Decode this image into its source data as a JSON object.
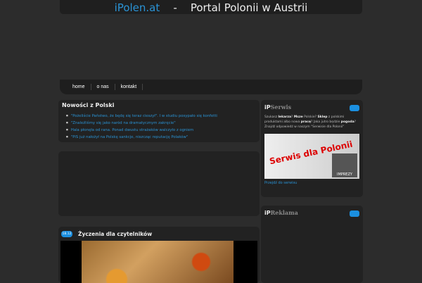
{
  "header": {
    "brand": "iPolen.at",
    "separator": "-",
    "tagline": "Portal Polonii w Austrii"
  },
  "nav": [
    {
      "label": "home"
    },
    {
      "label": "o nas"
    },
    {
      "label": "kontakt"
    }
  ],
  "news": {
    "title": "Nowości z Polski",
    "items": [
      "\"Pożeliście Państwo, że będę się teraz cieszył\". I w studiu posypało się konfetti",
      "\"Znaleźliśmy się jako naród na dramatycznym zakręcie\"",
      "Hala płonęła od rana. Ponad dwustu strażaków walczyło z ogniem",
      "\"PiS już nałożył na Polskę sankcje, niszcząc reputację Polaków\""
    ]
  },
  "article": {
    "date": "18.12",
    "title": "Życzenia dla czytelników"
  },
  "serwis": {
    "title_prefix": "iP",
    "title": "Serwis",
    "text": {
      "a": "Szukasz ",
      "b": "lekarza",
      "c": "? ",
      "d": "Mszе",
      "e": " Polskie? ",
      "f": "Sklep",
      "g": " z polskimi produktami albo nowa ",
      "h": "pracę",
      "i": "? Jaka jutro będzie ",
      "j": "pogoda",
      "k": "?",
      "l": "Znajdź odpowiedź w naszym \"Serwisie dla Polonii\""
    },
    "banner_text": "Serwis dla Polonii",
    "banner_label": "IMPREZY",
    "link": "Przejdź do serwisu"
  },
  "reklama": {
    "title_prefix": "iP",
    "title": "Reklama"
  }
}
